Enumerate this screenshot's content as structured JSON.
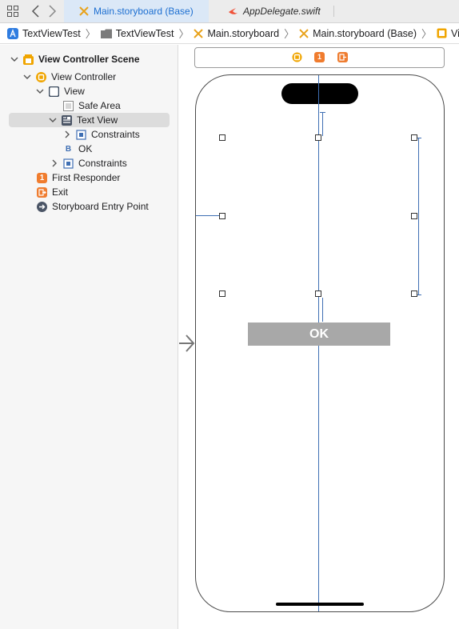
{
  "tabs": [
    {
      "label": "Main.storyboard (Base)",
      "active": true,
      "icon": "storyboard-icon"
    },
    {
      "label": "AppDelegate.swift",
      "active": false,
      "icon": "swift-icon"
    }
  ],
  "breadcrumbs": [
    "TextViewTest",
    "TextViewTest",
    "Main.storyboard",
    "Main.storyboard (Base)",
    "View Controlle"
  ],
  "outline": {
    "scene": "View Controller Scene",
    "view_controller": "View Controller",
    "view": "View",
    "safe_area": "Safe Area",
    "text_view": "Text View",
    "text_view_constraints": "Constraints",
    "ok_prefix": "B",
    "ok": "OK",
    "view_constraints": "Constraints",
    "first_responder": "First Responder",
    "first_responder_badge": "1",
    "exit": "Exit",
    "entry_point": "Storyboard Entry Point"
  },
  "canvas": {
    "scene_bar_badge": "1",
    "ok_button": "OK"
  },
  "colors": {
    "accent": "#1d6fd1",
    "vc_icon": "#f0a500",
    "first_responder": "#f07c2e",
    "exit": "#ef7d31",
    "constraint": "#3f6fb3"
  }
}
